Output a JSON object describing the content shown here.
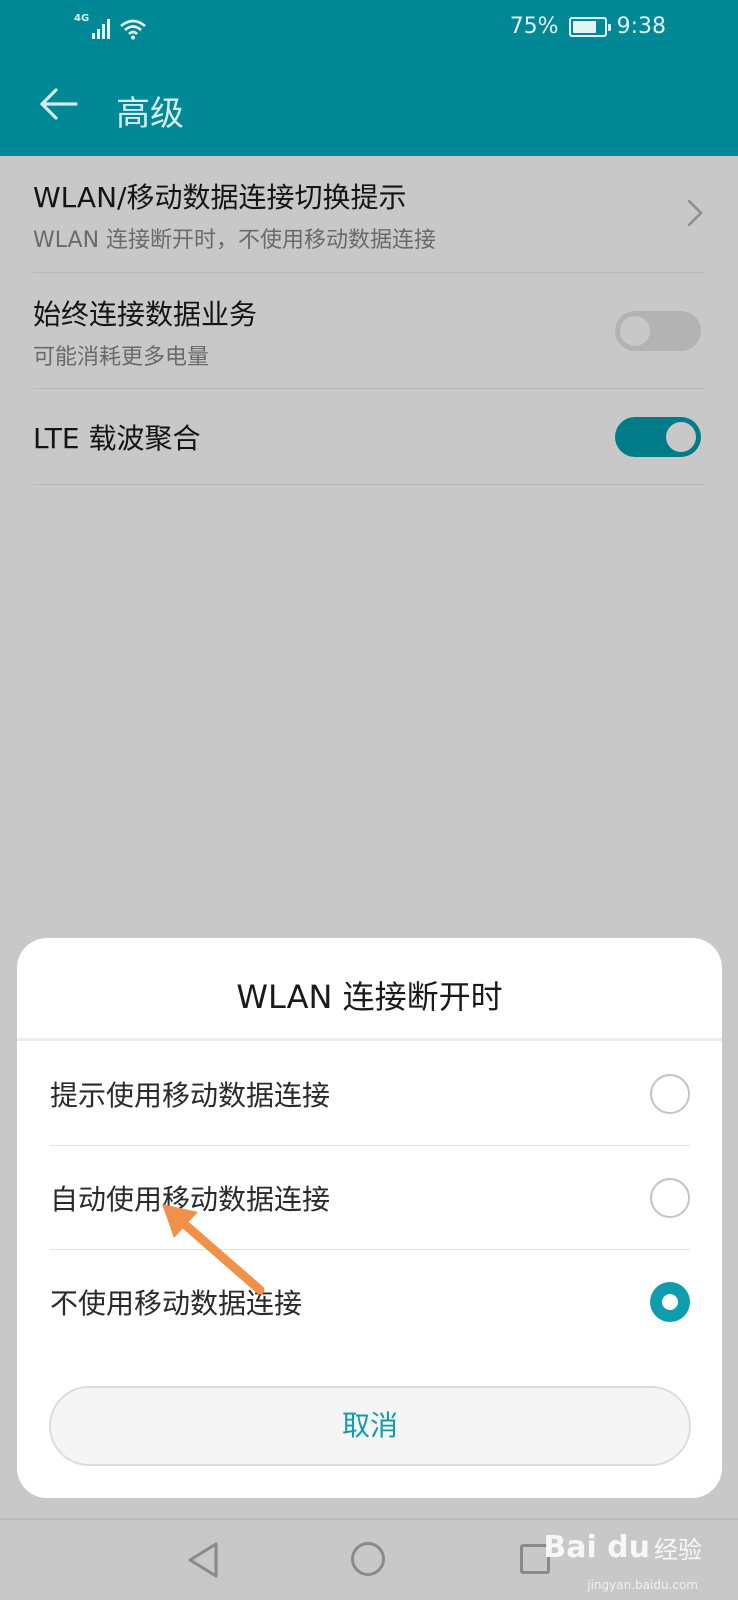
{
  "status_bar": {
    "network": "4G",
    "battery": "75%",
    "battery_level": 0.75,
    "time": "9:38"
  },
  "header": {
    "title": "高级",
    "back_icon": "arrow-left-icon"
  },
  "settings": {
    "items": [
      {
        "title": "WLAN/移动数据连接切换提示",
        "subtitle": "WLAN 连接断开时，不使用移动数据连接",
        "control": "chevron-right-icon"
      },
      {
        "title": "始终连接数据业务",
        "subtitle": "可能消耗更多电量",
        "control": "toggle",
        "enabled": false
      },
      {
        "title": "LTE 载波聚合",
        "control": "toggle",
        "enabled": true
      }
    ]
  },
  "dialog": {
    "title": "WLAN 连接断开时",
    "options": [
      {
        "label": "提示使用移动数据连接",
        "selected": false
      },
      {
        "label": "自动使用移动数据连接",
        "selected": false
      },
      {
        "label": "不使用移动数据连接",
        "selected": true
      }
    ],
    "cancel_label": "取消"
  },
  "annotation": {
    "icon": "orange-arrow-icon",
    "color": "#f0914a"
  },
  "watermark": {
    "logo": "Bai du",
    "text": "经验",
    "url": "jingyan.baidu.com"
  },
  "colors": {
    "accent": "#008896",
    "radio_selected": "#0f9cae",
    "toggle_on": "#007c88"
  }
}
